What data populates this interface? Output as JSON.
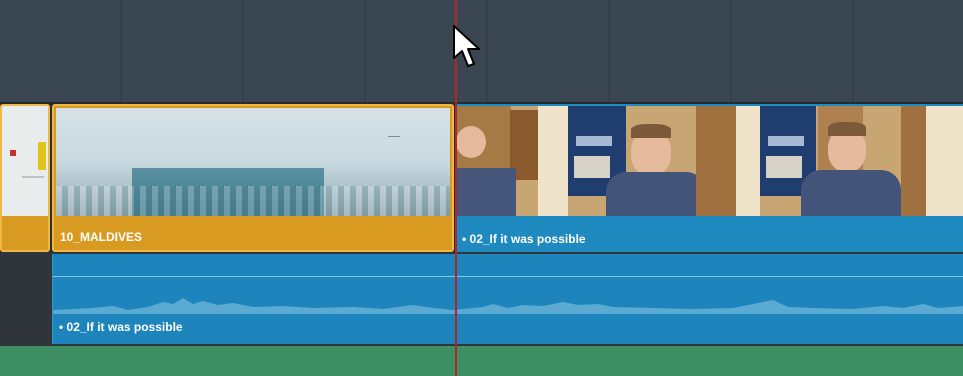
{
  "clips": {
    "video_left_clip": {
      "label": ""
    },
    "maldives": {
      "label": "10_MALDIVES",
      "color": "#d99a22"
    },
    "interview": {
      "label": "• 02_If it was possible",
      "color": "#1f8ac0"
    }
  },
  "audio": {
    "clip_label": "• 02_If it was possible",
    "color": "#1d85bb"
  },
  "playhead": {
    "color": "#b3242a"
  },
  "icons": {
    "cursor": "mouse-pointer-icon"
  }
}
